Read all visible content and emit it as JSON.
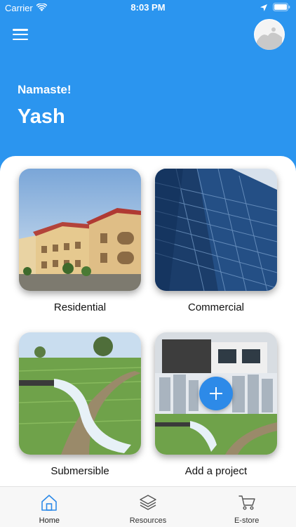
{
  "status_bar": {
    "carrier": "Carrier",
    "time": "8:03 PM"
  },
  "header": {
    "greeting": "Namaste!",
    "user_name": "Yash",
    "menu_icon": "hamburger-menu-icon",
    "avatar_icon": "avatar"
  },
  "cards": [
    {
      "label": "Residential",
      "image": "residential-buildings-photo"
    },
    {
      "label": "Commercial",
      "image": "glass-skyscraper-photo"
    },
    {
      "label": "Submersible",
      "image": "water-pipe-field-photo"
    },
    {
      "label": "Add a project",
      "image": "add-project-collage-photo",
      "action_icon": "plus-icon"
    }
  ],
  "tab_bar": {
    "items": [
      {
        "label": "Home",
        "icon": "home-icon",
        "active": true
      },
      {
        "label": "Resources",
        "icon": "layers-icon",
        "active": false
      },
      {
        "label": "E-store",
        "icon": "cart-icon",
        "active": false
      }
    ]
  },
  "colors": {
    "header_bg": "#2b95ef",
    "accent": "#2d8ae8",
    "active_tab": "#2d8ae8"
  }
}
